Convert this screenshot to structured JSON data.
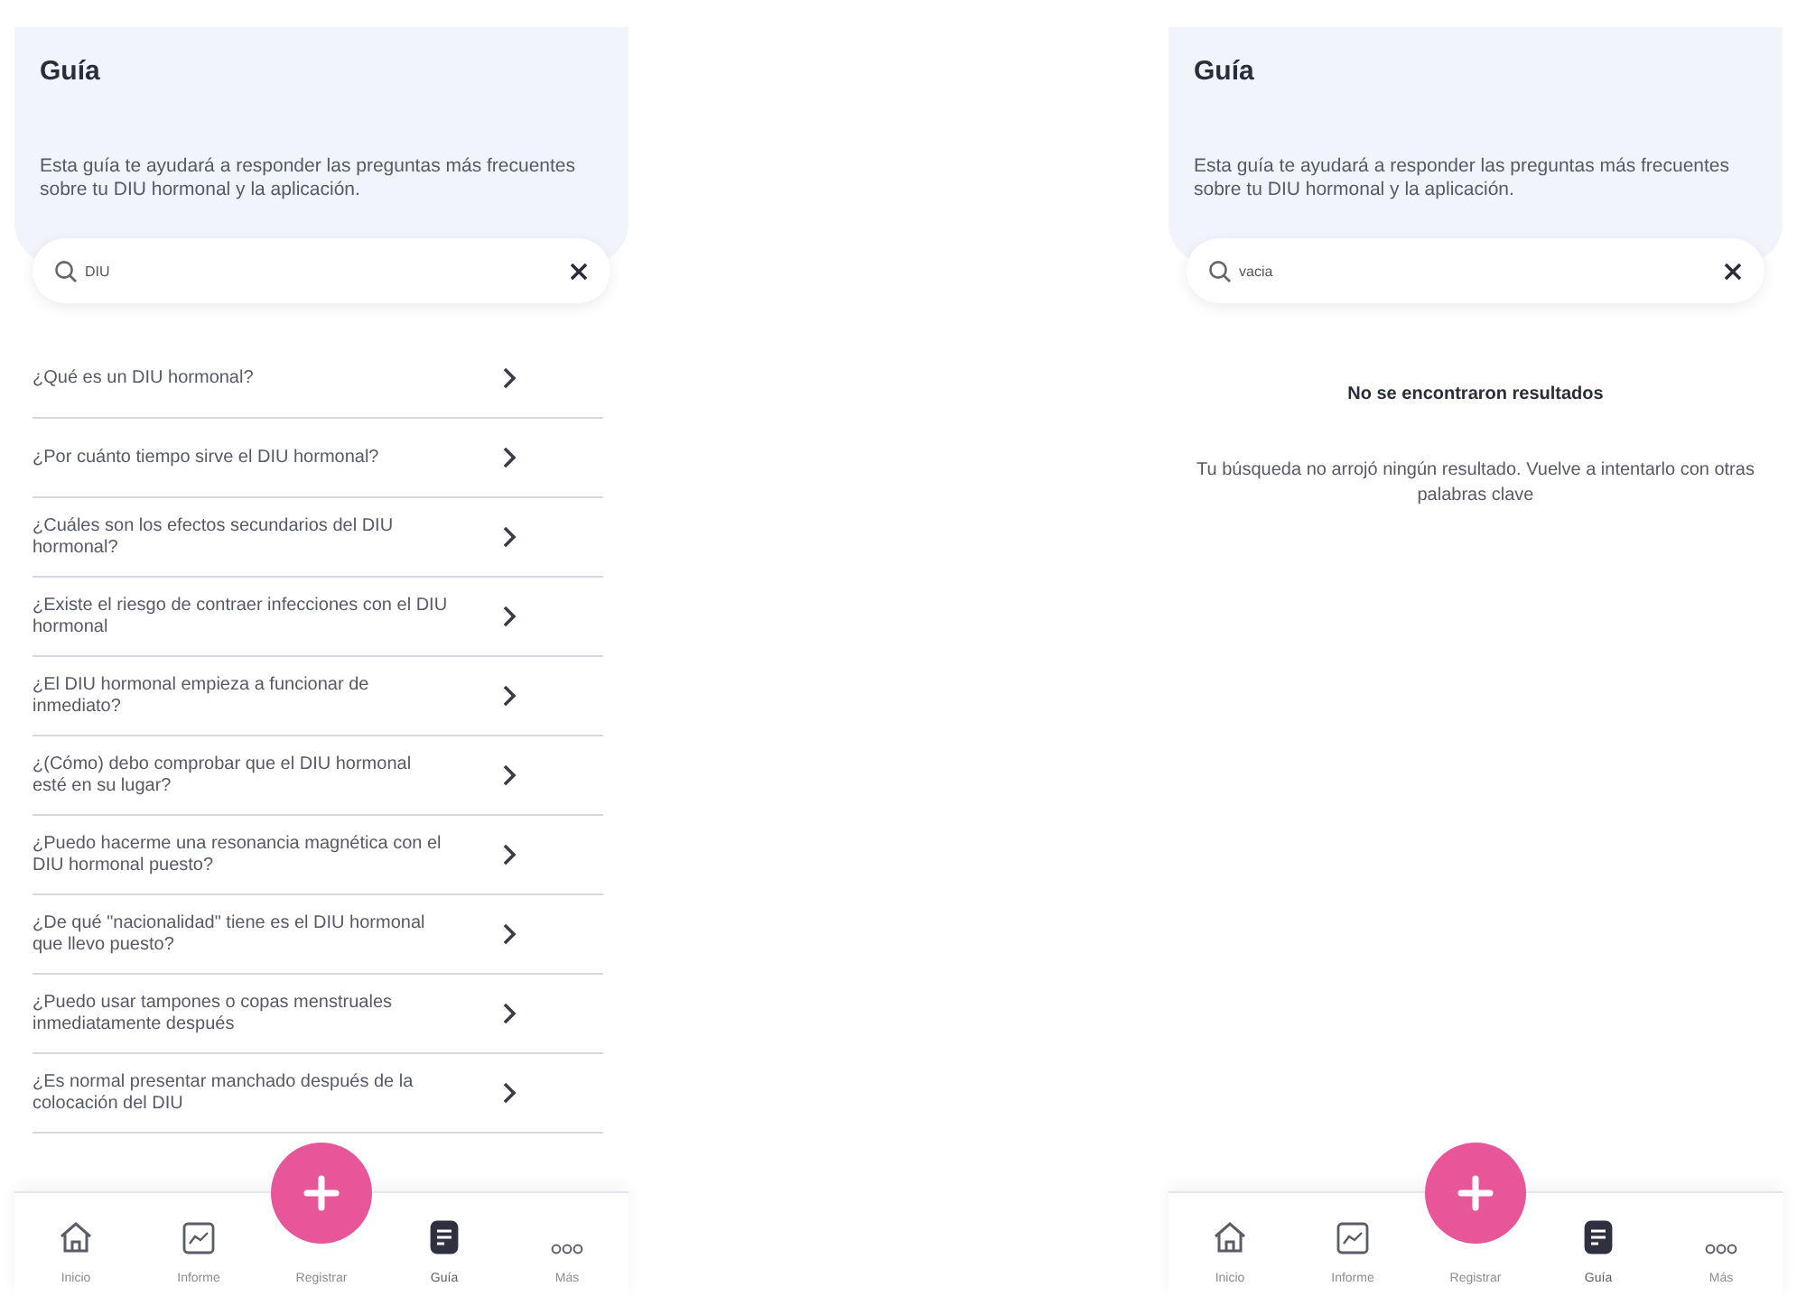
{
  "screens": [
    {
      "title": "Guía",
      "description": "Esta guía te ayudará a responder las preguntas más frecuentes sobre tu DIU hormonal y la aplicación.",
      "search": {
        "value": "DIU"
      },
      "results": [
        {
          "question": "¿Qué es un DIU hormonal?"
        },
        {
          "question": "¿Por cuánto tiempo sirve el DIU hormonal?"
        },
        {
          "question": "¿Cuáles son los efectos secundarios del DIU hormonal?"
        },
        {
          "question": "¿Existe el riesgo de contraer infecciones con el DIU hormonal"
        },
        {
          "question": "¿El DIU hormonal empieza a funcionar de inmediato?"
        },
        {
          "question": "¿(Cómo) debo comprobar que el DIU hormonal esté en su lugar?"
        },
        {
          "question": "¿Puedo hacerme una resonancia magnética con el DIU hormonal puesto?"
        },
        {
          "question": "¿De qué \"nacionalidad\" tiene es el DIU hormonal que llevo puesto?"
        },
        {
          "question": "¿Puedo usar tampones o copas menstruales inmediatamente después"
        },
        {
          "question": "¿Es normal presentar manchado después de la colocación del DIU"
        }
      ],
      "nav": [
        {
          "kind": "tab",
          "label": "Inicio",
          "selected": false
        },
        {
          "kind": "tab",
          "label": "Informe",
          "selected": false
        },
        {
          "kind": "action",
          "label": "Registrar",
          "selected": false
        },
        {
          "kind": "tab",
          "label": "Guía",
          "selected": true
        },
        {
          "kind": "tab",
          "label": "Más",
          "selected": false
        }
      ]
    },
    {
      "title": "Guía",
      "description": "Esta guía te ayudará a responder las preguntas más frecuentes sobre tu DIU hormonal y la aplicación.",
      "search": {
        "value": "vacia"
      },
      "empty": {
        "heading": "No se encontraron resultados",
        "message": "Tu búsqueda no arrojó ningún resultado. Vuelve a intentarlo con otras palabras clave"
      },
      "nav": [
        {
          "kind": "tab",
          "label": "Inicio",
          "selected": false
        },
        {
          "kind": "tab",
          "label": "Informe",
          "selected": false
        },
        {
          "kind": "action",
          "label": "Registrar",
          "selected": false
        },
        {
          "kind": "tab",
          "label": "Guía",
          "selected": true
        },
        {
          "kind": "tab",
          "label": "Más",
          "selected": false
        }
      ]
    }
  ]
}
